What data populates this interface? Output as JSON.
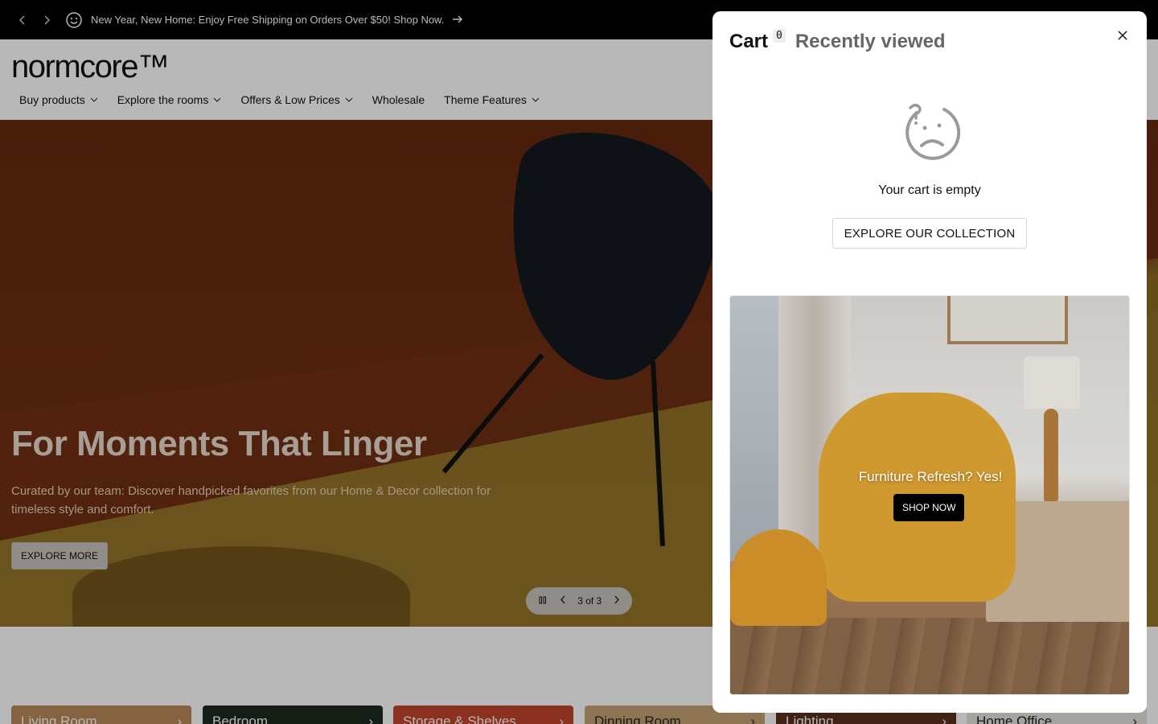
{
  "announcement": {
    "text": "New Year, New Home: Enjoy Free Shipping on Orders Over $50! Shop Now."
  },
  "header": {
    "logo": "normcore™",
    "nav": [
      {
        "label": "Buy products",
        "has_dropdown": true
      },
      {
        "label": "Explore the rooms",
        "has_dropdown": true
      },
      {
        "label": "Offers & Low Prices",
        "has_dropdown": true
      },
      {
        "label": "Wholesale",
        "has_dropdown": false
      },
      {
        "label": "Theme Features",
        "has_dropdown": true
      }
    ]
  },
  "hero": {
    "title": "For Moments That Linger",
    "subtitle": "Curated by our team: Discover handpicked favorites from our Home & Decor collection for timeless style and comfort.",
    "button_label": "EXPLORE MORE",
    "slide_indicator": "3 of 3"
  },
  "categories": [
    {
      "label": "Living Room",
      "color": "#b98a5a"
    },
    {
      "label": "Bedroom",
      "color": "#1d2a1c"
    },
    {
      "label": "Storage & Shelves",
      "color": "#c2452c"
    },
    {
      "label": "Dinning Room",
      "color": "#c4a275"
    },
    {
      "label": "Lighting",
      "color": "#5a2e1c"
    },
    {
      "label": "Home Office",
      "color": "#e7e4e0"
    }
  ],
  "cart_drawer": {
    "tab_cart": "Cart",
    "cart_count": "0",
    "tab_recent": "Recently viewed",
    "empty_message": "Your cart is empty",
    "explore_button": "EXPLORE OUR COLLECTION",
    "promo": {
      "title": "Furniture Refresh? Yes!",
      "button_label": "SHOP NOW"
    }
  },
  "colors": {
    "announcement_bg": "#000000",
    "drawer_bg": "#ffffff",
    "accent_button": "#000000"
  }
}
